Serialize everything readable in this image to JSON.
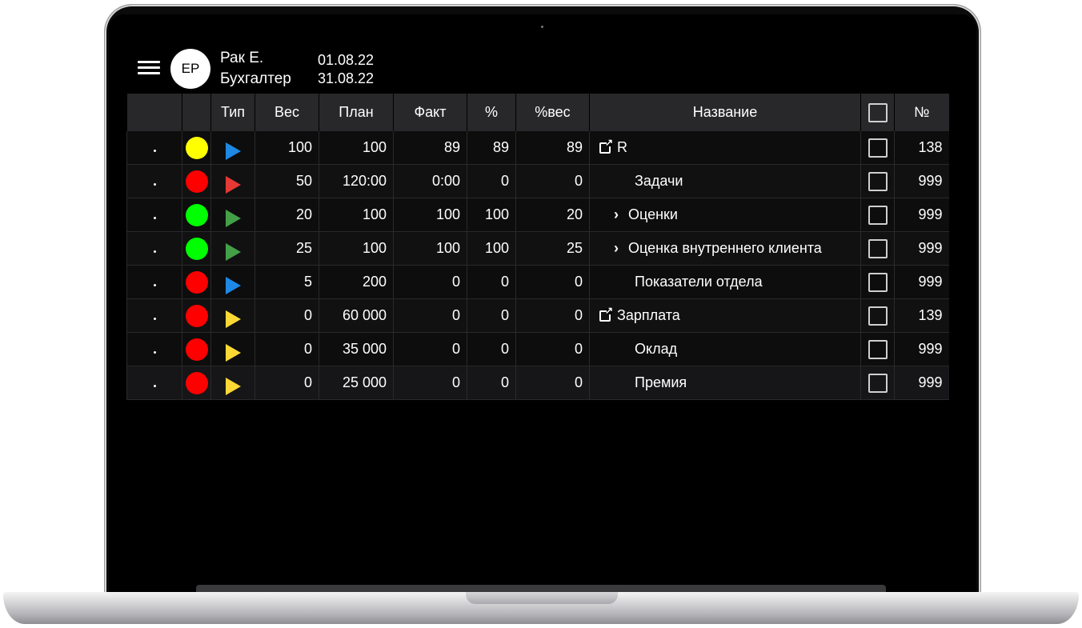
{
  "header": {
    "avatar_initials": "ЕР",
    "user_name": "Рак Е.",
    "user_role": "Бухгалтер",
    "date_from": "01.08.22",
    "date_to": "31.08.22"
  },
  "table": {
    "columns": [
      "",
      "",
      "Тип",
      "Вес",
      "План",
      "Факт",
      "%",
      "%вес",
      "Название",
      "",
      "№"
    ],
    "rows": [
      {
        "status_color": "#ffff00",
        "type_color": "#1e88e5",
        "weight": "100",
        "plan": "100",
        "fact": "89",
        "pct": "89",
        "pct_weight": "89",
        "name": "R",
        "name_style": "link",
        "number": "138"
      },
      {
        "status_color": "#ff0000",
        "type_color": "#e53935",
        "weight": "50",
        "plan": "120:00",
        "fact": "0:00",
        "pct": "0",
        "pct_weight": "0",
        "name": "Задачи",
        "name_style": "indent",
        "number": "999"
      },
      {
        "status_color": "#00ff00",
        "type_color": "#43a047",
        "weight": "20",
        "plan": "100",
        "fact": "100",
        "pct": "100",
        "pct_weight": "20",
        "name": "Оценки",
        "name_style": "expand",
        "number": "999"
      },
      {
        "status_color": "#00ff00",
        "type_color": "#43a047",
        "weight": "25",
        "plan": "100",
        "fact": "100",
        "pct": "100",
        "pct_weight": "25",
        "name": "Оценка внутреннего клиента",
        "name_style": "expand",
        "number": "999"
      },
      {
        "status_color": "#ff0000",
        "type_color": "#1e88e5",
        "weight": "5",
        "plan": "200",
        "fact": "0",
        "pct": "0",
        "pct_weight": "0",
        "name": "Показатели отдела",
        "name_style": "indent",
        "number": "999"
      },
      {
        "status_color": "#ff0000",
        "type_color": "#fdd835",
        "weight": "0",
        "plan": "60 000",
        "fact": "0",
        "pct": "0",
        "pct_weight": "0",
        "name": "Зарплата",
        "name_style": "link",
        "number": "139"
      },
      {
        "status_color": "#ff0000",
        "type_color": "#fdd835",
        "weight": "0",
        "plan": "35 000",
        "fact": "0",
        "pct": "0",
        "pct_weight": "0",
        "name": "Оклад",
        "name_style": "indent",
        "number": "999"
      },
      {
        "status_color": "#ff0000",
        "type_color": "#fdd835",
        "weight": "0",
        "plan": "25 000",
        "fact": "0",
        "pct": "0",
        "pct_weight": "0",
        "name": "Премия",
        "name_style": "indent",
        "number": "999"
      }
    ]
  },
  "icons": {
    "menu": "hamburger-icon",
    "link": "external-link-icon",
    "expand": "chevron-right-icon",
    "expand_glyph": "›"
  }
}
